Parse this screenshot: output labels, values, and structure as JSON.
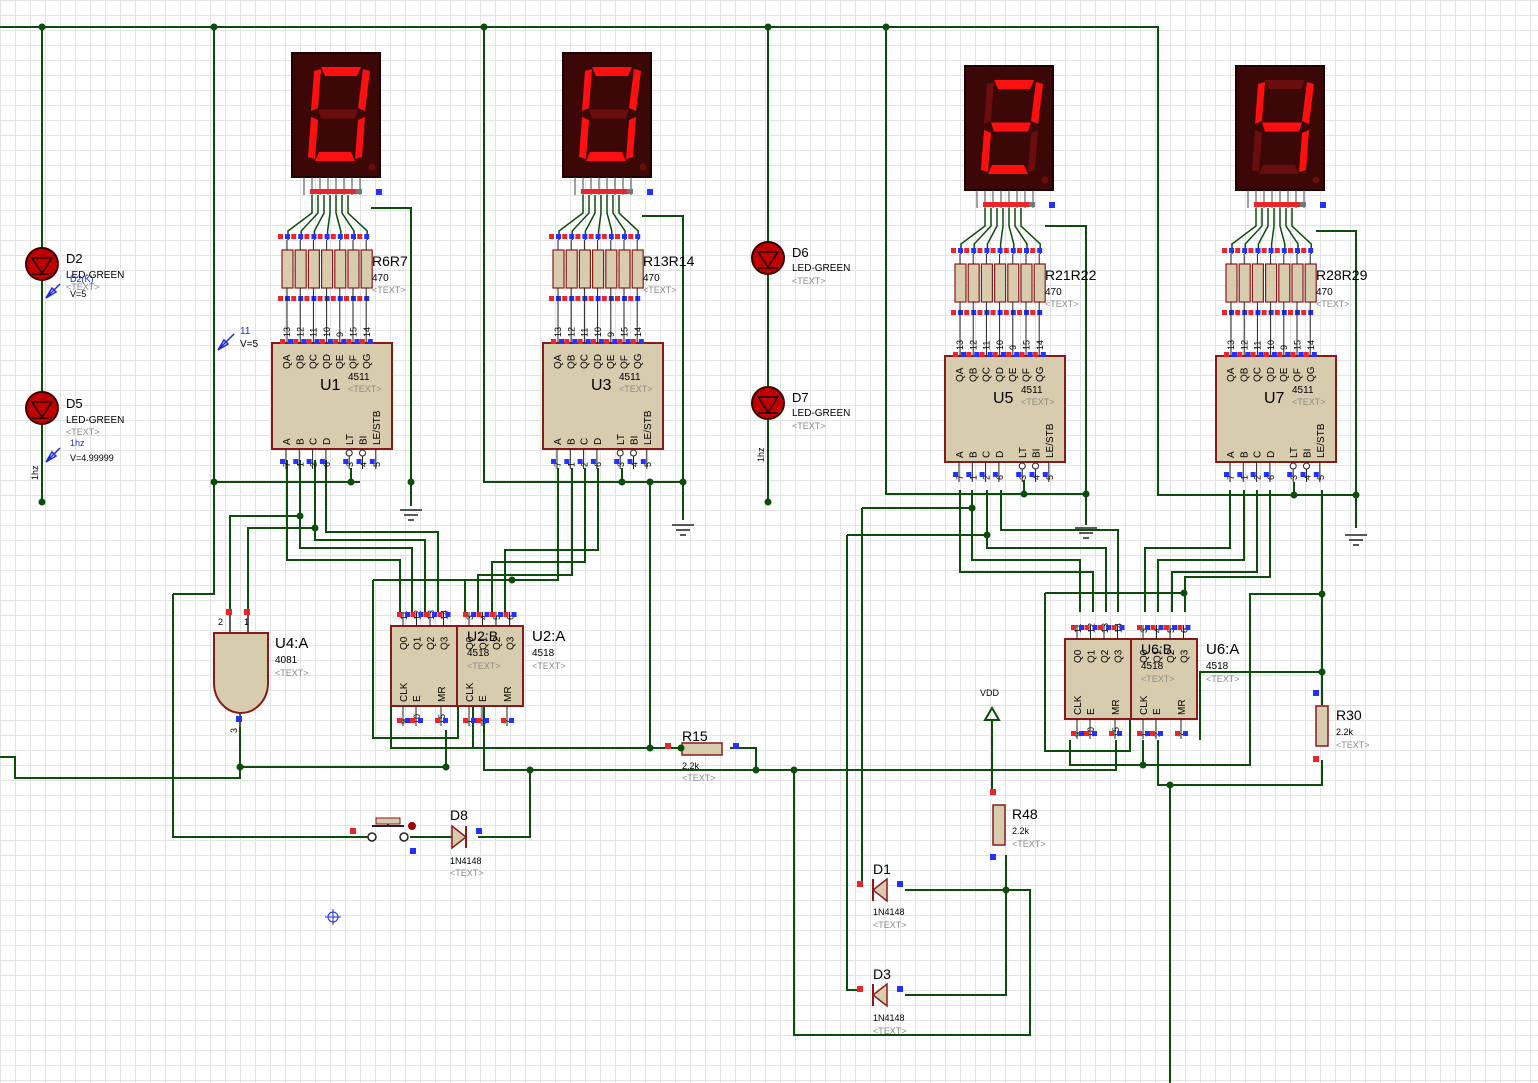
{
  "displays": [
    {
      "digit": "0",
      "chip": {
        "ref": "U1",
        "part": "4511",
        "text": "<TEXT>",
        "outputs": [
          "QA",
          "QB",
          "QC",
          "QD",
          "QE",
          "QF",
          "QG"
        ],
        "out_pins": [
          "13",
          "12",
          "11",
          "10",
          "9",
          "15",
          "14"
        ],
        "inputs": [
          "A",
          "B",
          "C",
          "D",
          "LT",
          "BI",
          "LE/STB"
        ],
        "in_pins": [
          "7",
          "1",
          "2",
          "6",
          "3",
          "4",
          "5"
        ]
      },
      "resistors": {
        "refs": "R6R7",
        "value": "470",
        "text": "<TEXT>"
      }
    },
    {
      "digit": "0",
      "chip": {
        "ref": "U3",
        "part": "4511",
        "text": "<TEXT>",
        "outputs": [
          "QA",
          "QB",
          "QC",
          "QD",
          "QE",
          "QF",
          "QG"
        ],
        "out_pins": [
          "13",
          "12",
          "11",
          "10",
          "9",
          "15",
          "14"
        ],
        "inputs": [
          "A",
          "B",
          "C",
          "D",
          "LT",
          "BI",
          "LE/STB"
        ],
        "in_pins": [
          "7",
          "1",
          "2",
          "6",
          "3",
          "4",
          "5"
        ]
      },
      "resistors": {
        "refs": "R13R14",
        "value": "470",
        "text": "<TEXT>"
      }
    },
    {
      "digit": "2",
      "chip": {
        "ref": "U5",
        "part": "4511",
        "text": "<TEXT>",
        "outputs": [
          "QA",
          "QB",
          "QC",
          "QD",
          "QE",
          "QF",
          "QG"
        ],
        "out_pins": [
          "13",
          "12",
          "11",
          "10",
          "9",
          "15",
          "14"
        ],
        "inputs": [
          "A",
          "B",
          "C",
          "D",
          "LT",
          "BI",
          "LE/STB"
        ],
        "in_pins": [
          "7",
          "1",
          "2",
          "6",
          "3",
          "4",
          "5"
        ]
      },
      "resistors": {
        "refs": "R21R22",
        "value": "470",
        "text": "<TEXT>"
      }
    },
    {
      "digit": "4",
      "chip": {
        "ref": "U7",
        "part": "4511",
        "text": "<TEXT>",
        "outputs": [
          "QA",
          "QB",
          "QC",
          "QD",
          "QE",
          "QF",
          "QG"
        ],
        "out_pins": [
          "13",
          "12",
          "11",
          "10",
          "9",
          "15",
          "14"
        ],
        "inputs": [
          "A",
          "B",
          "C",
          "D",
          "LT",
          "BI",
          "LE/STB"
        ],
        "in_pins": [
          "7",
          "1",
          "2",
          "6",
          "3",
          "4",
          "5"
        ]
      },
      "resistors": {
        "refs": "R28R29",
        "value": "470",
        "text": "<TEXT>"
      }
    }
  ],
  "leds": [
    {
      "ref": "D2",
      "part": "LED-GREEN",
      "text": "<TEXT>",
      "probe": "V=5",
      "probe_extra": "D2(K)"
    },
    {
      "ref": "D5",
      "part": "LED-GREEN",
      "text": "<TEXT>",
      "probe": "V=4.99999",
      "probe_extra": "1hz"
    },
    {
      "ref": "D6",
      "part": "LED-GREEN",
      "text": "<TEXT>"
    },
    {
      "ref": "D7",
      "part": "LED-GREEN",
      "text": "<TEXT>"
    }
  ],
  "probe_left": {
    "name": "11",
    "value": "V=5"
  },
  "clock_labels": [
    "1hz",
    "1hz"
  ],
  "counters": [
    {
      "refB": "U2:B",
      "refA": "U2:A",
      "part": "4518",
      "text": "<TEXT>",
      "top_pins_left": [
        "11",
        "12",
        "13",
        "14"
      ],
      "top_pins_right": [
        "3",
        "4",
        "5",
        "6"
      ],
      "bottom_pins_left": [
        "9",
        "10",
        "15"
      ],
      "bottom_pins_right": [
        "1",
        "2",
        "7"
      ],
      "q_labels": [
        "Q0",
        "Q1",
        "Q2",
        "Q3"
      ],
      "ctl_labels": [
        "CLK",
        "E",
        "MR"
      ]
    },
    {
      "refB": "U6:B",
      "refA": "U6:A",
      "part": "4518",
      "text": "<TEXT>",
      "top_pins_left": [
        "11",
        "12",
        "13",
        "14"
      ],
      "top_pins_right": [
        "3",
        "4",
        "5",
        "6"
      ],
      "bottom_pins_left": [
        "9",
        "10",
        "15"
      ],
      "bottom_pins_right": [
        "1",
        "2",
        "7"
      ],
      "q_labels": [
        "Q0",
        "Q1",
        "Q2",
        "Q3"
      ],
      "ctl_labels": [
        "CLK",
        "E",
        "MR"
      ]
    }
  ],
  "and_gate": {
    "ref": "U4:A",
    "part": "4081",
    "text": "<TEXT>",
    "pins": [
      "2",
      "1",
      "3"
    ]
  },
  "r15": {
    "ref": "R15",
    "value": "2.2k",
    "text": "<TEXT>"
  },
  "r30": {
    "ref": "R30",
    "value": "2.2k",
    "text": "<TEXT>"
  },
  "r48": {
    "ref": "R48",
    "value": "2.2k",
    "text": "<TEXT>"
  },
  "d8": {
    "ref": "D8",
    "part": "1N4148",
    "text": "<TEXT>"
  },
  "d1": {
    "ref": "D1",
    "part": "1N4148",
    "text": "<TEXT>"
  },
  "d3": {
    "ref": "D3",
    "part": "1N4148",
    "text": "<TEXT>"
  },
  "vdd": "VDD",
  "colors": {
    "wire": "#0b4d0b",
    "chip_fill": "#d8ccae",
    "chip_border": "#8a1a1a",
    "seg_on": "#ff1010",
    "seg_off": "#6a0d0d",
    "display_bg": "#3c0707",
    "pin_red": "#e8262c",
    "pin_blue": "#2332ff"
  }
}
